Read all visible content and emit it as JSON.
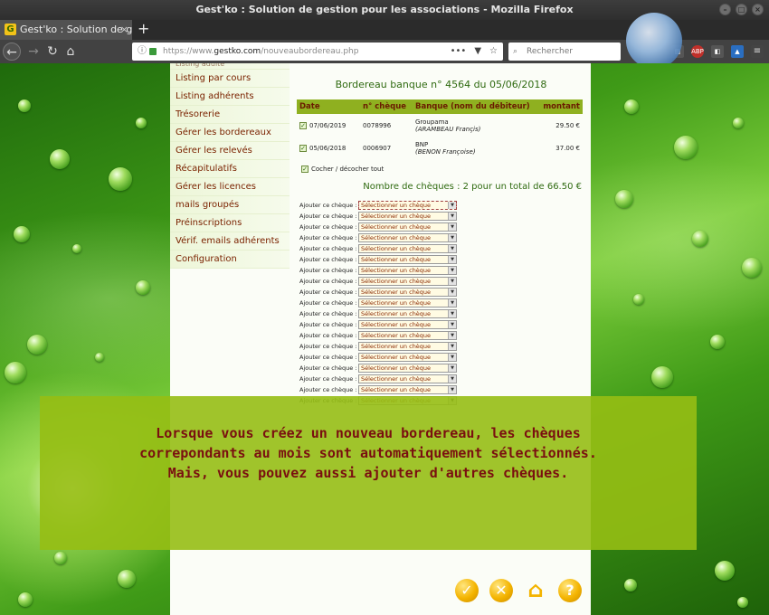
{
  "window": {
    "title": "Gest'ko : Solution de gestion pour les associations - Mozilla Firefox"
  },
  "tab": {
    "favicon": "G",
    "label": "Gest'ko : Solution de gestion",
    "close": "×"
  },
  "newtab": "+",
  "address_bar": {
    "url_prefix": "https://www.",
    "url_domain": "gestko.com",
    "url_path": "/nouveaubordereau.php"
  },
  "search": {
    "placeholder": "Rechercher"
  },
  "sidebar": {
    "items": [
      {
        "label": "Listing adulte"
      },
      {
        "label": "Listing par cours"
      },
      {
        "label": "Listing adhérents"
      },
      {
        "label": "Trésorerie"
      },
      {
        "label": "Gérer les bordereaux"
      },
      {
        "label": "Gérer les relevés"
      },
      {
        "label": "Récapitulatifs"
      },
      {
        "label": "Gérer les licences"
      },
      {
        "label": "mails groupés"
      },
      {
        "label": "Préinscriptions"
      },
      {
        "label": "Vérif. emails adhérents"
      },
      {
        "label": "Configuration"
      }
    ]
  },
  "bordereau": {
    "title": "Bordereau banque n° 4564 du 05/06/2018",
    "columns": {
      "date": "Date",
      "cheque": "n° chèque",
      "banque": "Banque (nom du débiteur)",
      "montant": "montant"
    },
    "rows": [
      {
        "date": "07/06/2019",
        "cheque": "0078996",
        "banque": "Groupama",
        "debiteur": "(ARAMBEAU Françis)",
        "montant": "29.50 €"
      },
      {
        "date": "05/06/2018",
        "cheque": "0006907",
        "banque": "BNP",
        "debiteur": "(BENON Françoise)",
        "montant": "37.00 €"
      }
    ],
    "toggle_all": "Cocher / décocher tout",
    "total": "Nombre de chèques : 2 pour un total de 66.50 €",
    "add_label": "Ajouter ce chèque :",
    "select_placeholder": "Sélectionner un chèque"
  },
  "overlay": {
    "line1": "Lorsque vous créez un nouveau bordereau, les chèques",
    "line2": "correpondants au mois sont automatiquement sélectionnés.",
    "line3": "Mais, vous pouvez aussi ajouter d'autres chèques."
  },
  "colors": {
    "sidebar_text": "#7a2200",
    "header_bg": "#8fb020",
    "overlay_bg": "#96be14",
    "overlay_text": "#7a0f10",
    "title_green": "#2f6a10"
  }
}
